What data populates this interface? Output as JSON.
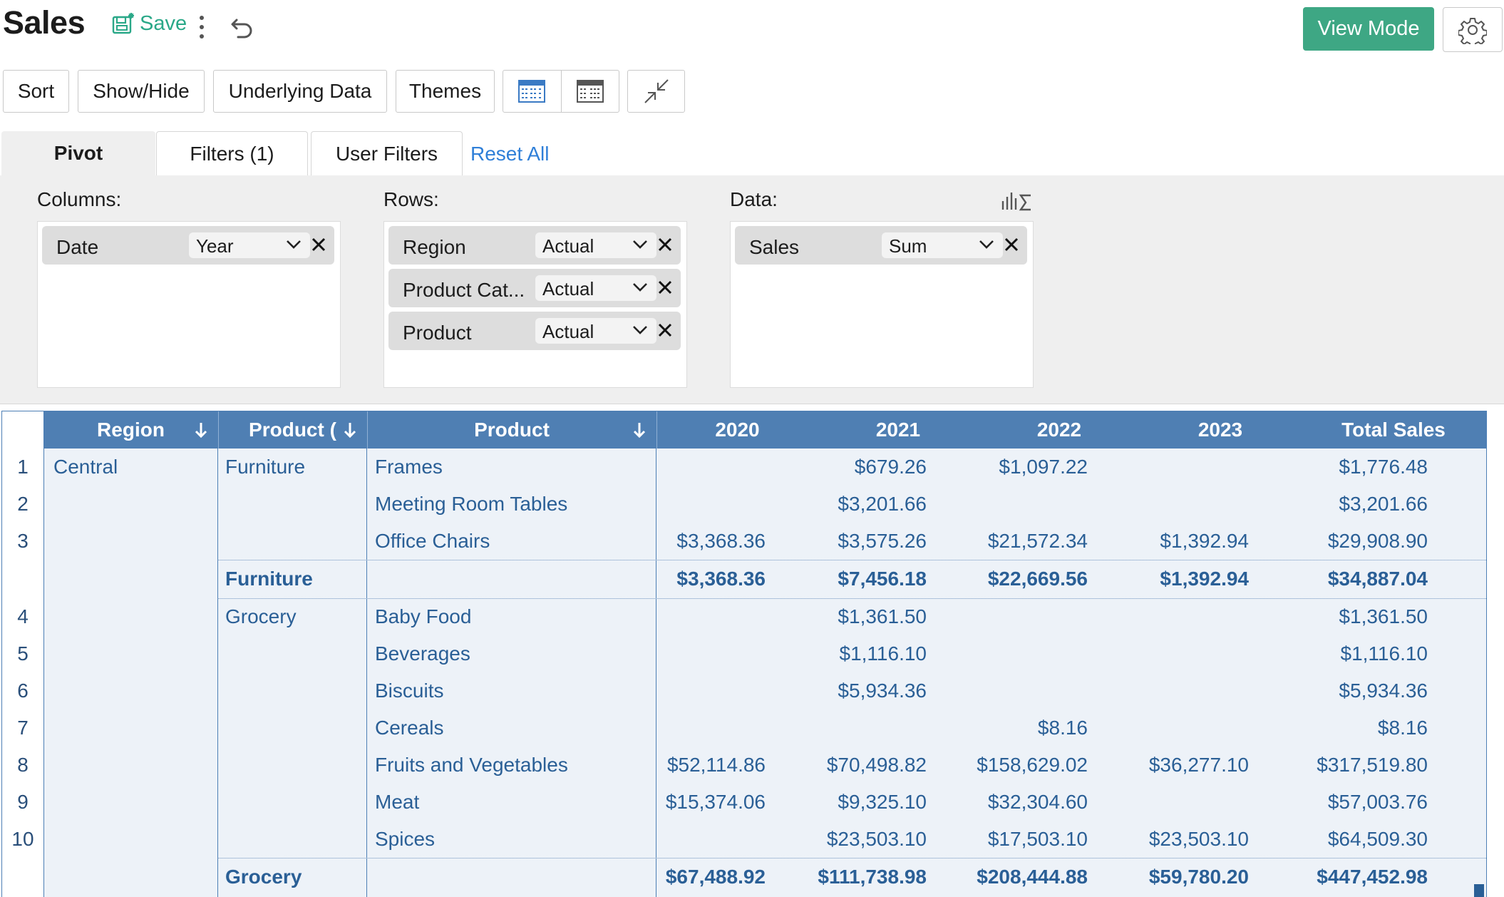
{
  "header": {
    "title": "Sales",
    "save_label": "Save",
    "view_mode_label": "View Mode"
  },
  "toolbar": {
    "sort": "Sort",
    "show_hide": "Show/Hide",
    "underlying_data": "Underlying Data",
    "themes": "Themes"
  },
  "tabs": {
    "pivot": "Pivot",
    "filters": "Filters  (1)",
    "user_filters": "User Filters",
    "reset_all": "Reset All"
  },
  "panel": {
    "columns_label": "Columns:",
    "rows_label": "Rows:",
    "data_label": "Data:",
    "columns": [
      {
        "field": "Date",
        "option": "Year"
      }
    ],
    "rows": [
      {
        "field": "Region",
        "option": "Actual"
      },
      {
        "field": "Product Cat...",
        "option": "Actual"
      },
      {
        "field": "Product",
        "option": "Actual"
      }
    ],
    "data": [
      {
        "field": "Sales",
        "option": "Sum"
      }
    ]
  },
  "table": {
    "headers": {
      "region": "Region",
      "category": "Product (",
      "product": "Product",
      "y2020": "2020",
      "y2021": "2021",
      "y2022": "2022",
      "y2023": "2023",
      "total": "Total Sales"
    },
    "row_numbers": [
      "1",
      "2",
      "3",
      "4",
      "5",
      "6",
      "7",
      "8",
      "9",
      "10"
    ],
    "region": "Central",
    "furniture": {
      "category": "Furniture",
      "rows": [
        {
          "product": "Frames",
          "y2020": "",
          "y2021": "$679.26",
          "y2022": "$1,097.22",
          "y2023": "",
          "total": "$1,776.48"
        },
        {
          "product": "Meeting Room Tables",
          "y2020": "",
          "y2021": "$3,201.66",
          "y2022": "",
          "y2023": "",
          "total": "$3,201.66"
        },
        {
          "product": "Office Chairs",
          "y2020": "$3,368.36",
          "y2021": "$3,575.26",
          "y2022": "$21,572.34",
          "y2023": "$1,392.94",
          "total": "$29,908.90"
        }
      ],
      "subtotal": {
        "label": "Furniture",
        "y2020": "$3,368.36",
        "y2021": "$7,456.18",
        "y2022": "$22,669.56",
        "y2023": "$1,392.94",
        "total": "$34,887.04"
      }
    },
    "grocery": {
      "category": "Grocery",
      "rows": [
        {
          "product": "Baby Food",
          "y2020": "",
          "y2021": "$1,361.50",
          "y2022": "",
          "y2023": "",
          "total": "$1,361.50"
        },
        {
          "product": "Beverages",
          "y2020": "",
          "y2021": "$1,116.10",
          "y2022": "",
          "y2023": "",
          "total": "$1,116.10"
        },
        {
          "product": "Biscuits",
          "y2020": "",
          "y2021": "$5,934.36",
          "y2022": "",
          "y2023": "",
          "total": "$5,934.36"
        },
        {
          "product": "Cereals",
          "y2020": "",
          "y2021": "",
          "y2022": "$8.16",
          "y2023": "",
          "total": "$8.16"
        },
        {
          "product": "Fruits and Vegetables",
          "y2020": "$52,114.86",
          "y2021": "$70,498.82",
          "y2022": "$158,629.02",
          "y2023": "$36,277.10",
          "total": "$317,519.80"
        },
        {
          "product": "Meat",
          "y2020": "$15,374.06",
          "y2021": "$9,325.10",
          "y2022": "$32,304.60",
          "y2023": "",
          "total": "$57,003.76"
        },
        {
          "product": "Spices",
          "y2020": "",
          "y2021": "$23,503.10",
          "y2022": "$17,503.10",
          "y2023": "$23,503.10",
          "total": "$64,509.30"
        }
      ],
      "subtotal": {
        "label": "Grocery",
        "y2020": "$67,488.92",
        "y2021": "$111,738.98",
        "y2022": "$208,444.88",
        "y2023": "$59,780.20",
        "total": "$447,452.98"
      }
    }
  },
  "colors": {
    "accent_green": "#3ea784",
    "header_blue": "#4f7fb3",
    "link_blue": "#2f7fd8",
    "cell_text": "#2a5f96",
    "cell_bg": "#edf2f8"
  }
}
